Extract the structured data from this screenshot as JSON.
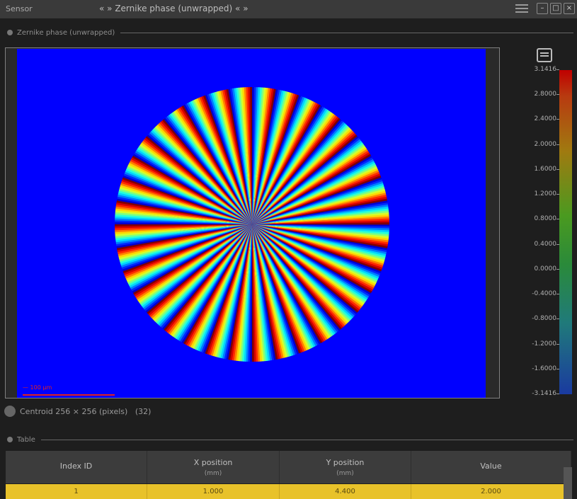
{
  "titlebar": {
    "left_label": "Sensor",
    "title": "« » Zernike phase (unwrapped) « »",
    "buttons": [
      "–",
      "□",
      "×"
    ]
  },
  "image_section": {
    "label": "Zernike phase (unwrapped)"
  },
  "plot": {
    "background_color": "#0000ff",
    "spokes": 36,
    "scale_label": "— 100 µm",
    "colormap": "jet"
  },
  "colorbar": {
    "icon": "colorbar-settings-icon",
    "ticks": [
      "3.1416",
      "2.8000",
      "2.4000",
      "2.0000",
      "1.6000",
      "1.2000",
      "0.8000",
      "0.4000",
      "0.0000",
      "-0.4000",
      "-0.8000",
      "-1.2000",
      "-1.6000",
      "-3.1416"
    ]
  },
  "status": {
    "text": "Centroid 256 × 256 (pixels)   (32)"
  },
  "table_section": {
    "label": "Table"
  },
  "table": {
    "columns": [
      {
        "label": "Index ID",
        "unit": ""
      },
      {
        "label": "X position",
        "unit": "(mm)"
      },
      {
        "label": "Y position",
        "unit": "(mm)"
      },
      {
        "label": "Value",
        "unit": ""
      }
    ],
    "rows": [
      [
        "1",
        "1.000",
        "4.400",
        "2.000"
      ]
    ],
    "highlight_color": "#e8c22a"
  }
}
